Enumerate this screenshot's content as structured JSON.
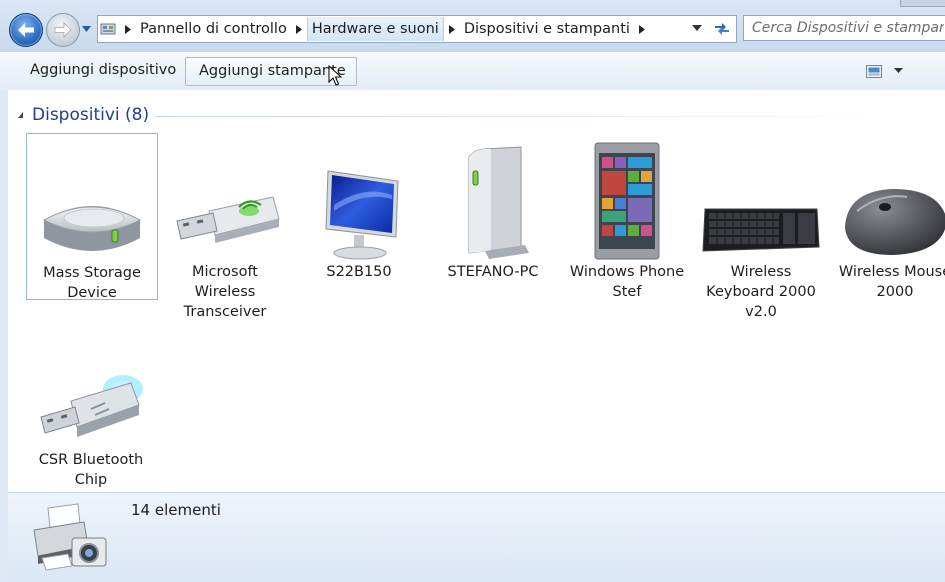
{
  "address": {
    "crumbs": [
      "Pannello di controllo",
      "Hardware e suoni",
      "Dispositivi e stampanti"
    ],
    "search_placeholder": "Cerca Dispositivi e stampanti"
  },
  "toolbar": {
    "add_device": "Aggiungi dispositivo",
    "add_printer": "Aggiungi stampante"
  },
  "group": {
    "title": "Dispositivi (8)"
  },
  "devices": [
    {
      "label": "Mass Storage Device",
      "icon": "hard-drive-icon"
    },
    {
      "label": "Microsoft Wireless Transceiver",
      "icon": "usb-stick-icon"
    },
    {
      "label": "S22B150",
      "icon": "monitor-icon"
    },
    {
      "label": "STEFANO-PC",
      "icon": "pc-tower-icon"
    },
    {
      "label": "Windows Phone Stef",
      "icon": "phone-icon"
    },
    {
      "label": "Wireless Keyboard 2000 v2.0",
      "icon": "keyboard-icon"
    },
    {
      "label": "Wireless Mouse 2000",
      "icon": "mouse-icon"
    },
    {
      "label": "CSR Bluetooth Chip",
      "icon": "bluetooth-dongle-icon"
    }
  ],
  "details": {
    "count": "14 elementi"
  },
  "colors": {
    "accent": "#1e3f8f",
    "selection_border": "#8fb3dd"
  }
}
